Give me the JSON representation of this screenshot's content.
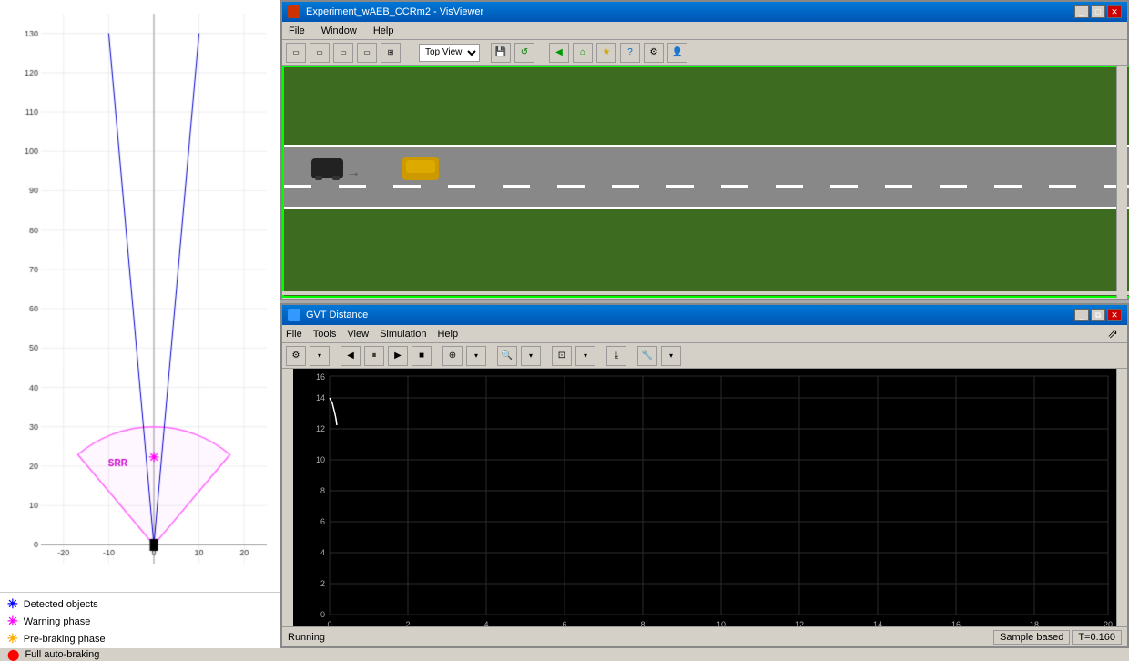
{
  "left_panel": {
    "axis": {
      "x_labels": [
        "-20",
        "-10",
        "0",
        "10",
        "20"
      ],
      "y_labels": [
        "0",
        "10",
        "20",
        "30",
        "40",
        "50",
        "60",
        "70",
        "80",
        "90",
        "100",
        "110",
        "120",
        "130"
      ]
    },
    "legend": {
      "items": [
        {
          "label": "Detected objects",
          "color": "#0000ff",
          "shape": "asterisk"
        },
        {
          "label": "Warning phase",
          "color": "#ff00ff",
          "shape": "asterisk"
        },
        {
          "label": "Pre-braking phase",
          "color": "#ffaa00",
          "shape": "asterisk"
        },
        {
          "label": "Full auto-braking",
          "color": "#ff0000",
          "shape": "circle"
        }
      ]
    },
    "srr_label": "SRR"
  },
  "vis_viewer": {
    "title": "Experiment_wAEB_CCRm2 - VisViewer",
    "menu": [
      "File",
      "Window",
      "Help"
    ],
    "toolbar": {
      "view_select": "Top View",
      "buttons": [
        "save",
        "refresh",
        "back",
        "home",
        "star",
        "help",
        "settings",
        "person"
      ]
    },
    "viewport": {
      "bg_color": "#3d6b1f",
      "road_color": "#888888"
    }
  },
  "gvt_window": {
    "title": "GVT Distance",
    "menu": [
      "File",
      "Tools",
      "View",
      "Simulation",
      "Help"
    ],
    "plot": {
      "bg_color": "#000000",
      "y_max": 16,
      "y_min": 0,
      "y_step": 2,
      "x_max": 20,
      "x_min": 0,
      "x_step": 2,
      "y_labels": [
        "0",
        "2",
        "4",
        "6",
        "8",
        "10",
        "12",
        "14",
        "16"
      ],
      "x_labels": [
        "0",
        "2",
        "4",
        "6",
        "8",
        "10",
        "12",
        "14",
        "16",
        "18",
        "20"
      ]
    },
    "statusbar": {
      "status": "Running",
      "sample_label": "Sample based",
      "time_label": "T=0.160"
    }
  }
}
